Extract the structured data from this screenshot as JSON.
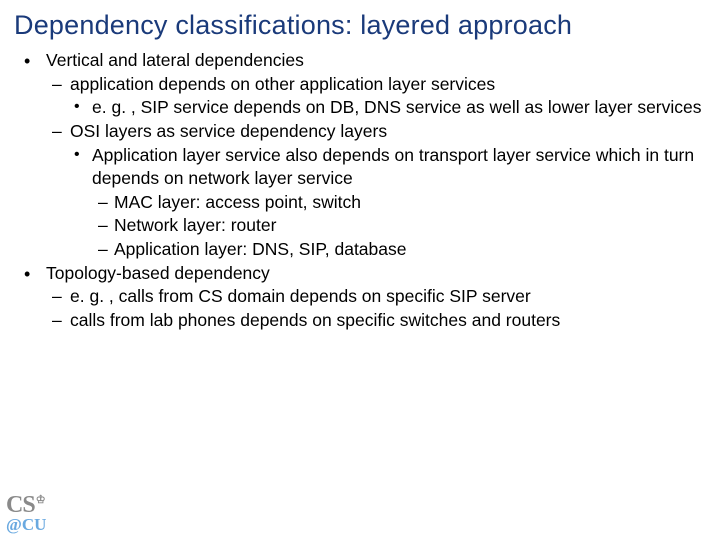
{
  "title": "Dependency classifications:  layered approach",
  "bullets": [
    {
      "text": "Vertical and lateral dependencies",
      "children": [
        {
          "text": "application depends on other application layer services",
          "children": [
            {
              "text": "e. g. , SIP service depends on DB, DNS service as well as lower layer services"
            }
          ]
        },
        {
          "text": "OSI layers as service dependency layers",
          "children": [
            {
              "text": "Application layer service also depends on transport layer service which in turn depends on network layer service",
              "children": [
                {
                  "text": "MAC layer: access point, switch"
                },
                {
                  "text": "Network layer: router"
                },
                {
                  "text": "Application layer: DNS, SIP, database"
                }
              ]
            }
          ]
        }
      ]
    },
    {
      "text": "Topology-based dependency",
      "children": [
        {
          "text": "e. g. , calls from CS domain depends on specific SIP server"
        },
        {
          "text": "calls from lab phones depends on specific switches and routers"
        }
      ]
    }
  ],
  "logo": {
    "cs": "CS",
    "cu": "@CU",
    "crown": "♔"
  }
}
